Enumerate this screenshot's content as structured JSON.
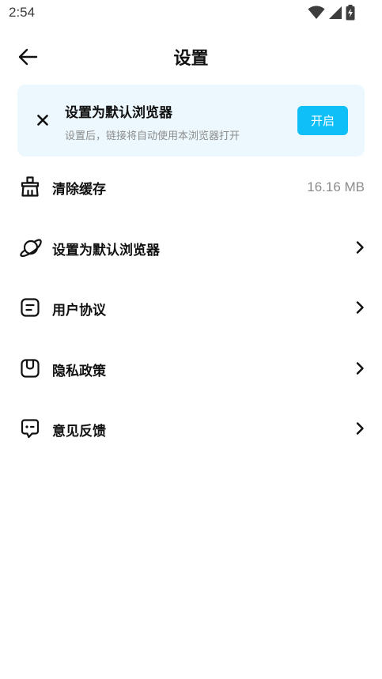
{
  "status_bar": {
    "time": "2:54",
    "icons": [
      "wifi-icon",
      "signal-icon",
      "battery-charging-icon"
    ]
  },
  "header": {
    "back_icon": "arrow-left-icon",
    "title": "设置"
  },
  "banner": {
    "close_icon": "close-icon",
    "title": "设置为默认浏览器",
    "subtitle": "设置后，链接将自动使用本浏览器打开",
    "button_label": "开启",
    "background_color": "#ecf8fd",
    "button_color": "#0fbff7"
  },
  "settings": {
    "items": [
      {
        "icon": "broom-icon",
        "label": "清除缓存",
        "value": "16.16 MB",
        "has_chevron": false
      },
      {
        "icon": "planet-icon",
        "label": "设置为默认浏览器",
        "has_chevron": true
      },
      {
        "icon": "agreement-icon",
        "label": "用户协议",
        "has_chevron": true
      },
      {
        "icon": "privacy-icon",
        "label": "隐私政策",
        "has_chevron": true
      },
      {
        "icon": "feedback-icon",
        "label": "意见反馈",
        "has_chevron": true
      }
    ]
  }
}
